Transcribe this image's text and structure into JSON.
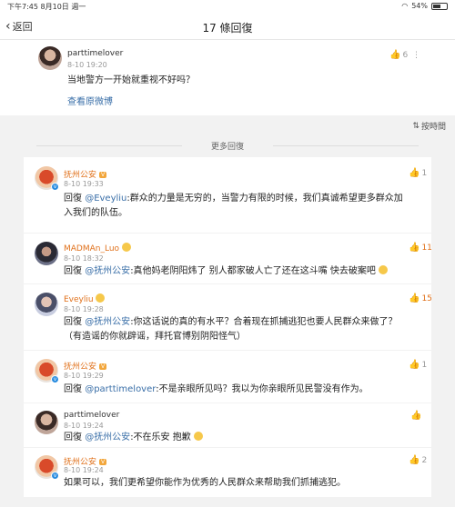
{
  "status_bar": {
    "time": "下午7:45",
    "date": "8月10日 週一",
    "battery": "54%",
    "battery_level": 0.54
  },
  "nav": {
    "back_label": "返回",
    "title": "17 條回復"
  },
  "top_comment": {
    "username": "parttimelover",
    "timestamp": "8-10 19:20",
    "text": "当地警方一开始就重视不好吗？",
    "view_original": "查看原微博",
    "likes": "6"
  },
  "sort_label": "按時間",
  "more_replies": "更多回復",
  "replies": [
    {
      "username": "抚州公安",
      "timestamp": "8-10 19:33",
      "prefix": "回復 ",
      "mention": "@Eveyliu",
      "text": ":群众的力量是无穷的，当警力有限的时候，我们真诚希望更多群众加入我们的队伍。",
      "likes": "1"
    },
    {
      "username": "MADMAn_Luo",
      "timestamp": "8-10 18:32",
      "prefix": "回復 ",
      "mention": "@抚州公安",
      "text": ":真他妈老阴阳炜了 别人都家破人亡了还在这斗嘴 快去破案吧",
      "likes": "11"
    },
    {
      "username": "Eveyliu",
      "timestamp": "8-10 19:28",
      "prefix": "回復 ",
      "mention": "@抚州公安",
      "text": ":你这话说的真的有水平？合着现在抓捕逃犯也要人民群众来做了？（有造谣的你就辟谣，拜托官博别阴阳怪气）",
      "likes": "15"
    },
    {
      "username": "抚州公安",
      "timestamp": "8-10 19:29",
      "prefix": "回復 ",
      "mention": "@parttimelover",
      "text": ":不是亲眼所见吗？我以为你亲眼所见民警没有作为。",
      "likes": "1"
    },
    {
      "username": "parttimelover",
      "timestamp": "8-10 19:24",
      "prefix": "回復 ",
      "mention": "@抚州公安",
      "text": ":不在乐安 抱歉",
      "likes": ""
    },
    {
      "username": "抚州公安",
      "timestamp": "8-10 19:24",
      "prefix": "",
      "mention": "",
      "text": "如果可以，我们更希望你能作为优秀的人民群众来帮助我们抓捕逃犯。",
      "likes": "2"
    }
  ]
}
